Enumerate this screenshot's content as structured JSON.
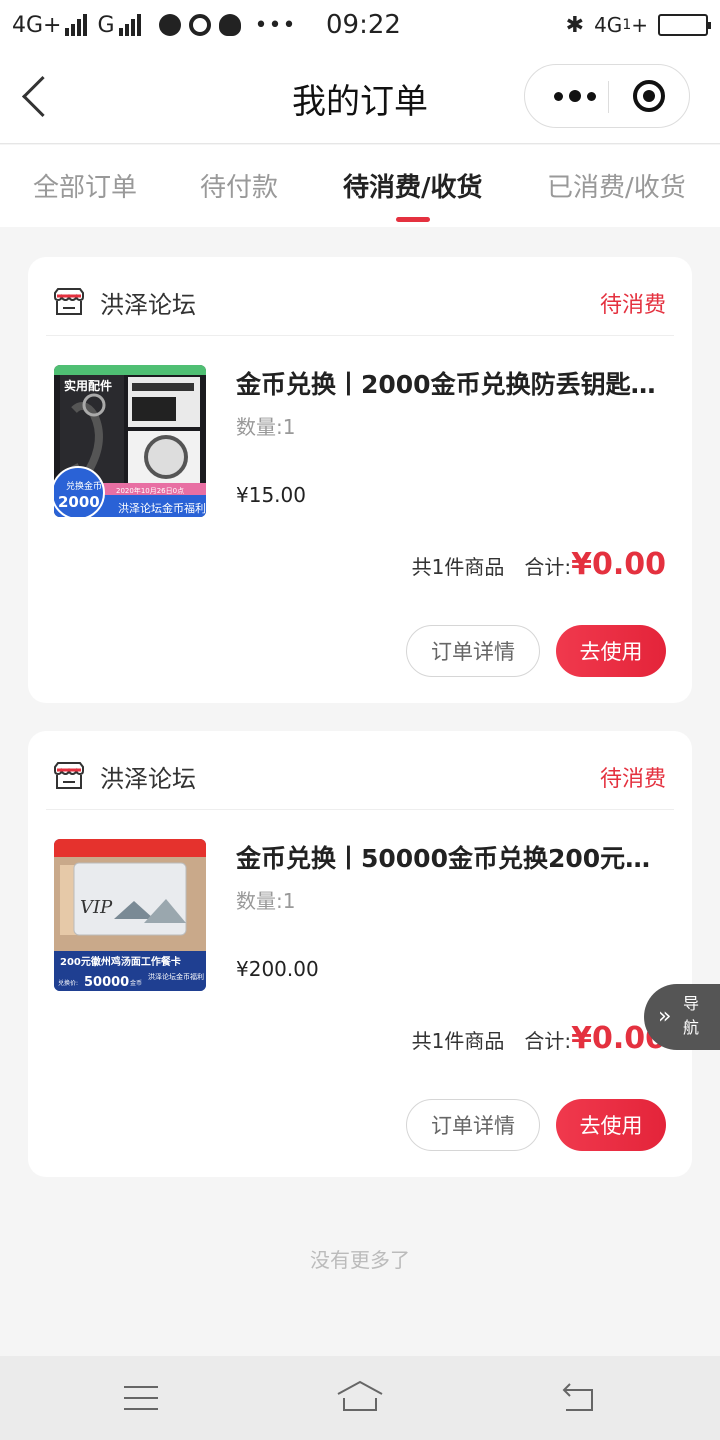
{
  "status_bar": {
    "net1": "4G+",
    "net2": "G",
    "time": "09:22",
    "net3": "4G",
    "net3_sub": "1",
    "net3_plus": "+"
  },
  "header": {
    "title": "我的订单"
  },
  "tabs": [
    {
      "label": "全部订单",
      "active": false
    },
    {
      "label": "待付款",
      "active": false
    },
    {
      "label": "待消费/收货",
      "active": true
    },
    {
      "label": "已消费/收货",
      "active": false
    }
  ],
  "orders": [
    {
      "shop": "洪泽论坛",
      "status": "待消费",
      "product_title": "金币兑换丨2000金币兑换防丢钥匙…",
      "quantity": "数量:1",
      "price": "¥15.00",
      "count_text": "共1件商品",
      "total_label": "合计:",
      "total": "¥0.00",
      "detail_btn": "订单详情",
      "use_btn": "去使用",
      "thumb": {
        "banner": "实用配件",
        "coin_label": "兑换金币",
        "coin_value": "2000",
        "date_text": "2020年10月26日0点",
        "footer": "洪泽论坛金币福利"
      }
    },
    {
      "shop": "洪泽论坛",
      "status": "待消费",
      "product_title": "金币兑换丨50000金币兑换200元…",
      "quantity": "数量:1",
      "price": "¥200.00",
      "count_text": "共1件商品",
      "total_label": "合计:",
      "total": "¥0.00",
      "detail_btn": "订单详情",
      "use_btn": "去使用",
      "thumb": {
        "card_text": "VIP",
        "headline": "200元徽州鸡汤面工作餐卡",
        "coin_label": "兑换价:",
        "coin_value": "50000",
        "unit": "金币",
        "footer": "洪泽论坛金币福利"
      }
    }
  ],
  "no_more": "没有更多了",
  "float_nav": {
    "arrow": "»",
    "label": "导航"
  },
  "colors": {
    "accent": "#e4313f",
    "background": "#f5f5f5"
  },
  "icons": [
    "back-arrow-icon",
    "more-icon",
    "close-target-icon",
    "shop-icon",
    "menu-icon",
    "home-icon",
    "return-icon"
  ]
}
